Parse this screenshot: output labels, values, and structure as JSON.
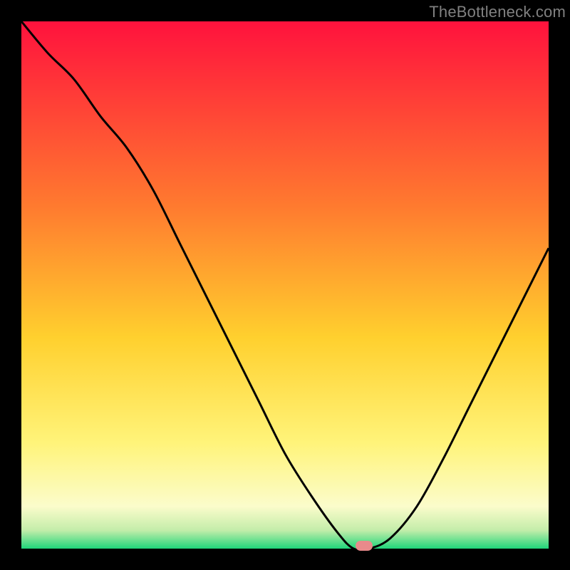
{
  "attribution": "TheBottleneck.com",
  "chart_data": {
    "type": "line",
    "title": "",
    "xlabel": "",
    "ylabel": "",
    "xlim": [
      0,
      100
    ],
    "ylim": [
      0,
      100
    ],
    "grid": false,
    "legend": false,
    "x": [
      0,
      5,
      10,
      15,
      20,
      25,
      30,
      35,
      40,
      45,
      50,
      55,
      60,
      63,
      66,
      70,
      75,
      80,
      85,
      90,
      95,
      100
    ],
    "values": [
      100,
      94,
      89,
      82,
      76,
      68,
      58,
      48,
      38,
      28,
      18,
      10,
      3,
      0,
      0,
      2,
      8,
      17,
      27,
      37,
      47,
      57
    ],
    "marker_x": 65,
    "gradient_stops": [
      {
        "offset": 0.0,
        "color": "#ff123d"
      },
      {
        "offset": 0.35,
        "color": "#ff7a2f"
      },
      {
        "offset": 0.6,
        "color": "#ffd02e"
      },
      {
        "offset": 0.8,
        "color": "#fff47a"
      },
      {
        "offset": 0.92,
        "color": "#fbfccb"
      },
      {
        "offset": 0.965,
        "color": "#c4edaa"
      },
      {
        "offset": 1.0,
        "color": "#1fd67a"
      }
    ]
  }
}
